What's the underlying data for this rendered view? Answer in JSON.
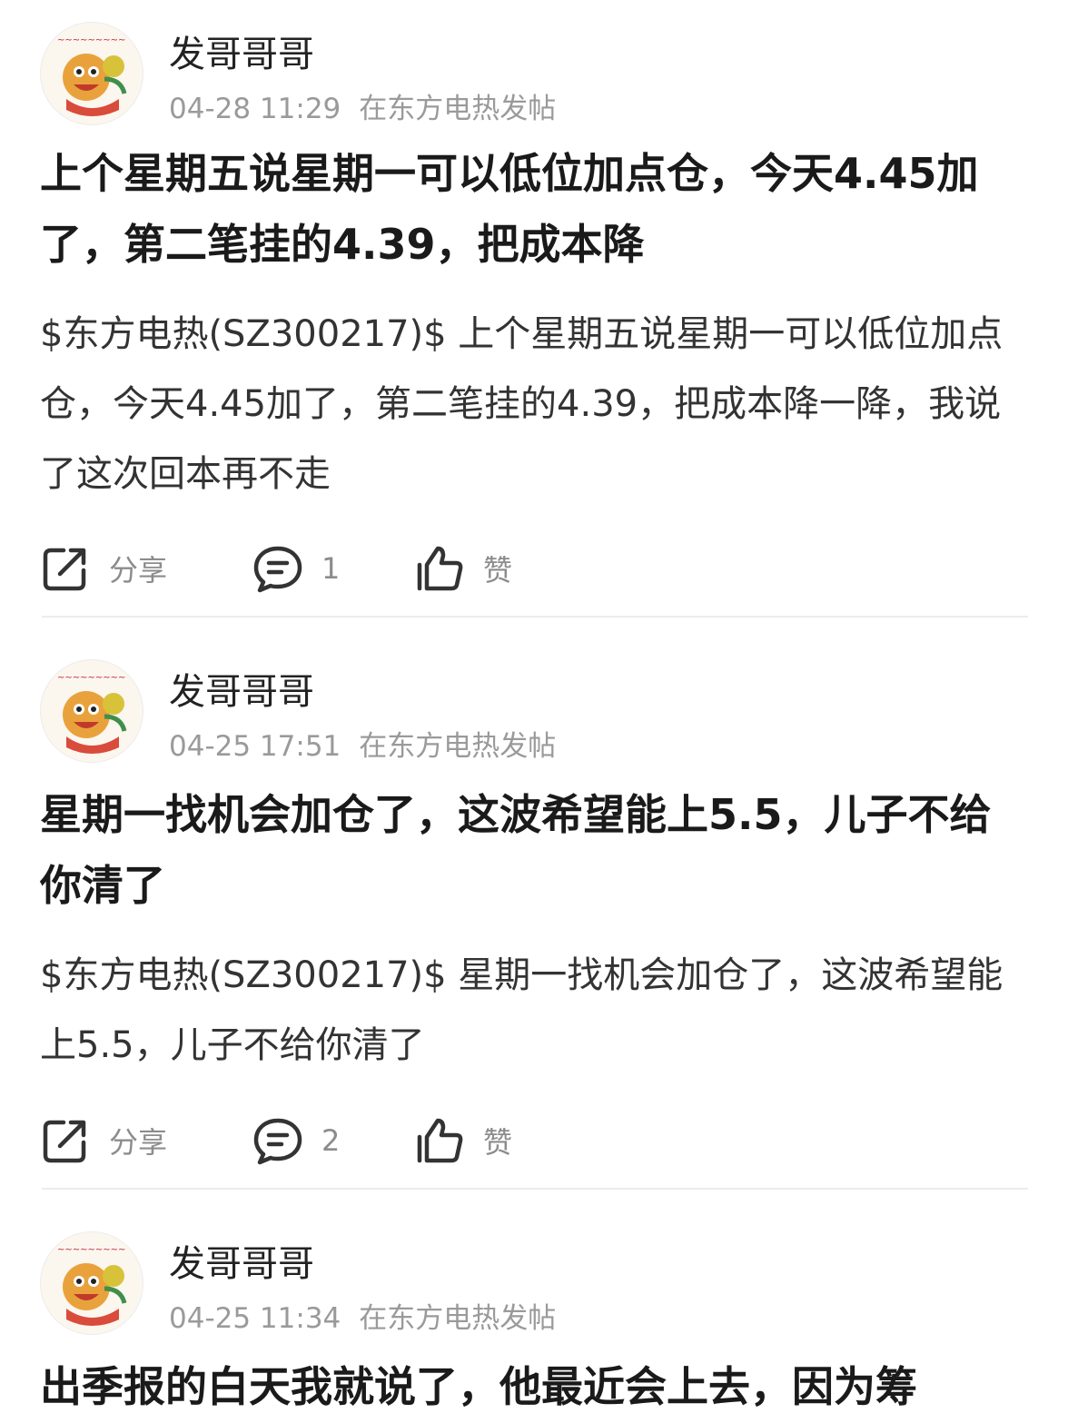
{
  "posts": [
    {
      "author": "发哥哥哥",
      "time": "04-28 11:29",
      "source": "在东方电热发帖",
      "title": "上个星期五说星期一可以低位加点仓，今天4.45加了，第二笔挂的4.39，把成本降",
      "body": "$东方电热(SZ300217)$ 上个星期五说星期一可以低位加点仓，今天4.45加了，第二笔挂的4.39，把成本降一降，我说了这次回本再不走",
      "share_label": "分享",
      "comment_count": "1",
      "like_label": "赞"
    },
    {
      "author": "发哥哥哥",
      "time": "04-25 17:51",
      "source": "在东方电热发帖",
      "title": "星期一找机会加仓了，这波希望能上5.5，儿子不给你清了",
      "body": "$东方电热(SZ300217)$ 星期一找机会加仓了，这波希望能上5.5，儿子不给你清了",
      "share_label": "分享",
      "comment_count": "2",
      "like_label": "赞"
    },
    {
      "author": "发哥哥哥",
      "time": "04-25 11:34",
      "source": "在东方电热发帖",
      "title": "出季报的白天我就说了，他最近会上去，因为筹"
    }
  ],
  "icons": {
    "share": "share-icon",
    "comment": "comment-icon",
    "like": "thumbs-up-icon",
    "avatar": "lion-dance-avatar"
  },
  "colors": {
    "meta_text": "#9a9a9a",
    "action_text": "#8c8c8c",
    "divider": "#ececec"
  }
}
